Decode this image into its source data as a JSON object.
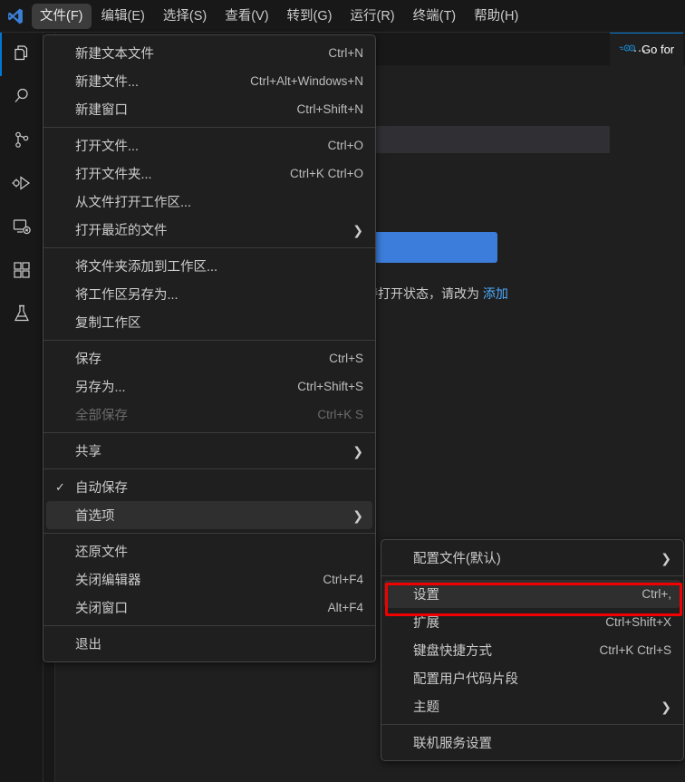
{
  "titlebar": {
    "logo_icon": "vscode-logo-icon",
    "menus": [
      {
        "label": "文件(F)",
        "active": true
      },
      {
        "label": "编辑(E)",
        "active": false
      },
      {
        "label": "选择(S)",
        "active": false
      },
      {
        "label": "查看(V)",
        "active": false
      },
      {
        "label": "转到(G)",
        "active": false
      },
      {
        "label": "运行(R)",
        "active": false
      },
      {
        "label": "终端(T)",
        "active": false
      },
      {
        "label": "帮助(H)",
        "active": false
      }
    ]
  },
  "activitybar": {
    "items": [
      {
        "name": "explorer",
        "icon": "files-icon",
        "selected": true
      },
      {
        "name": "search",
        "icon": "search-icon",
        "selected": false
      },
      {
        "name": "source-control",
        "icon": "source-control-icon",
        "selected": false
      },
      {
        "name": "run-and-debug",
        "icon": "run-debug-icon",
        "selected": false
      },
      {
        "name": "remote-explorer",
        "icon": "remote-explorer-icon",
        "selected": false
      },
      {
        "name": "extensions",
        "icon": "extensions-icon",
        "selected": false
      },
      {
        "name": "testing",
        "icon": "beaker-icon",
        "selected": false
      }
    ]
  },
  "editor": {
    "tab": {
      "label": "Go for",
      "icon": "go-logo-icon"
    },
    "more_actions": "…",
    "welcome_text_prefix": "使其保持打开状态，请改为 ",
    "welcome_text_link": "添加"
  },
  "file_menu": {
    "groups": [
      {
        "items": [
          {
            "label": "新建文本文件",
            "key": "Ctrl+N",
            "arrow": false,
            "check": "",
            "disabled": false,
            "highlight": false
          },
          {
            "label": "新建文件...",
            "key": "Ctrl+Alt+Windows+N",
            "arrow": false,
            "check": "",
            "disabled": false,
            "highlight": false
          },
          {
            "label": "新建窗口",
            "key": "Ctrl+Shift+N",
            "arrow": false,
            "check": "",
            "disabled": false,
            "highlight": false
          }
        ]
      },
      {
        "items": [
          {
            "label": "打开文件...",
            "key": "Ctrl+O",
            "arrow": false,
            "check": "",
            "disabled": false,
            "highlight": false
          },
          {
            "label": "打开文件夹...",
            "key": "Ctrl+K Ctrl+O",
            "arrow": false,
            "check": "",
            "disabled": false,
            "highlight": false
          },
          {
            "label": "从文件打开工作区...",
            "key": "",
            "arrow": false,
            "check": "",
            "disabled": false,
            "highlight": false
          },
          {
            "label": "打开最近的文件",
            "key": "",
            "arrow": true,
            "check": "",
            "disabled": false,
            "highlight": false
          }
        ]
      },
      {
        "items": [
          {
            "label": "将文件夹添加到工作区...",
            "key": "",
            "arrow": false,
            "check": "",
            "disabled": false,
            "highlight": false
          },
          {
            "label": "将工作区另存为...",
            "key": "",
            "arrow": false,
            "check": "",
            "disabled": false,
            "highlight": false
          },
          {
            "label": "复制工作区",
            "key": "",
            "arrow": false,
            "check": "",
            "disabled": false,
            "highlight": false
          }
        ]
      },
      {
        "items": [
          {
            "label": "保存",
            "key": "Ctrl+S",
            "arrow": false,
            "check": "",
            "disabled": false,
            "highlight": false
          },
          {
            "label": "另存为...",
            "key": "Ctrl+Shift+S",
            "arrow": false,
            "check": "",
            "disabled": false,
            "highlight": false
          },
          {
            "label": "全部保存",
            "key": "Ctrl+K S",
            "arrow": false,
            "check": "",
            "disabled": true,
            "highlight": false
          }
        ]
      },
      {
        "items": [
          {
            "label": "共享",
            "key": "",
            "arrow": true,
            "check": "",
            "disabled": false,
            "highlight": false
          }
        ]
      },
      {
        "items": [
          {
            "label": "自动保存",
            "key": "",
            "arrow": false,
            "check": "✓",
            "disabled": false,
            "highlight": false
          },
          {
            "label": "首选项",
            "key": "",
            "arrow": true,
            "check": "",
            "disabled": false,
            "highlight": true
          }
        ]
      },
      {
        "items": [
          {
            "label": "还原文件",
            "key": "",
            "arrow": false,
            "check": "",
            "disabled": false,
            "highlight": false
          },
          {
            "label": "关闭编辑器",
            "key": "Ctrl+F4",
            "arrow": false,
            "check": "",
            "disabled": false,
            "highlight": false
          },
          {
            "label": "关闭窗口",
            "key": "Alt+F4",
            "arrow": false,
            "check": "",
            "disabled": false,
            "highlight": false
          }
        ]
      },
      {
        "items": [
          {
            "label": "退出",
            "key": "",
            "arrow": false,
            "check": "",
            "disabled": false,
            "highlight": false
          }
        ]
      }
    ]
  },
  "prefs_menu": {
    "groups": [
      {
        "items": [
          {
            "label": "配置文件(默认)",
            "key": "",
            "arrow": true,
            "check": "",
            "disabled": false,
            "highlight": false
          }
        ]
      },
      {
        "items": [
          {
            "label": "设置",
            "key": "Ctrl+,",
            "arrow": false,
            "check": "",
            "disabled": false,
            "highlight": true
          },
          {
            "label": "扩展",
            "key": "Ctrl+Shift+X",
            "arrow": false,
            "check": "",
            "disabled": false,
            "highlight": false
          },
          {
            "label": "键盘快捷方式",
            "key": "Ctrl+K Ctrl+S",
            "arrow": false,
            "check": "",
            "disabled": false,
            "highlight": false
          },
          {
            "label": "配置用户代码片段",
            "key": "",
            "arrow": false,
            "check": "",
            "disabled": false,
            "highlight": false
          },
          {
            "label": "主题",
            "key": "",
            "arrow": true,
            "check": "",
            "disabled": false,
            "highlight": false
          }
        ]
      },
      {
        "items": [
          {
            "label": "联机服务设置",
            "key": "",
            "arrow": false,
            "check": "",
            "disabled": false,
            "highlight": false
          }
        ]
      }
    ]
  },
  "annotation": {
    "name": "settings-highlight-box",
    "color": "#f00000"
  },
  "colors": {
    "accent": "#0078d4",
    "menu_bg": "#1f1f1f",
    "menu_highlight": "#2f2f2f",
    "button_blue": "#3c7ddb",
    "link_blue": "#4daafc"
  }
}
